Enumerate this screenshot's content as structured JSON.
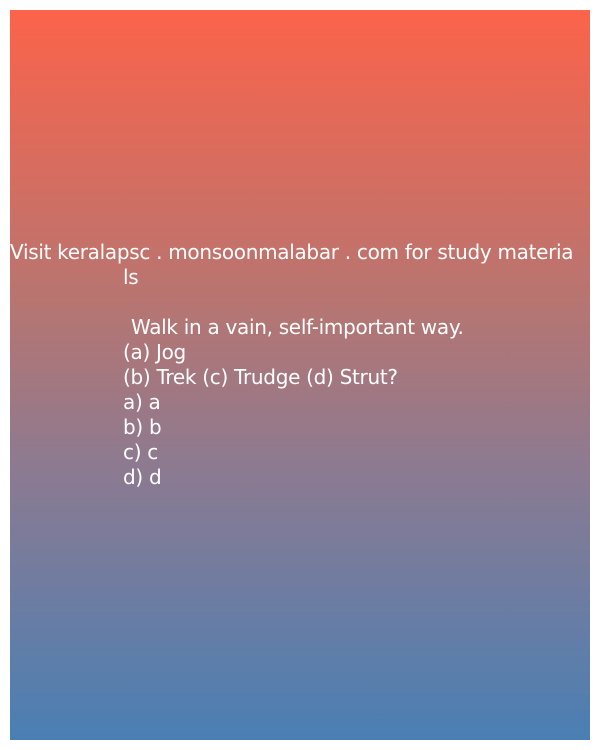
{
  "header": {
    "visit_line": "Visit keralapsc . monsoonmalabar . com for study materia",
    "visit_wrap": "ls"
  },
  "question": {
    "text": "Walk in a vain, self-important way.",
    "line1": "(a) Jog",
    "line2": "(b) Trek (c) Trudge (d) Strut?"
  },
  "answers": [
    "a) a",
    "b) b",
    "c) c",
    "d) d"
  ],
  "colors": {
    "gradient_top": "#fc634a",
    "gradient_bottom": "#4a7fb4",
    "text": "#ffffff"
  }
}
